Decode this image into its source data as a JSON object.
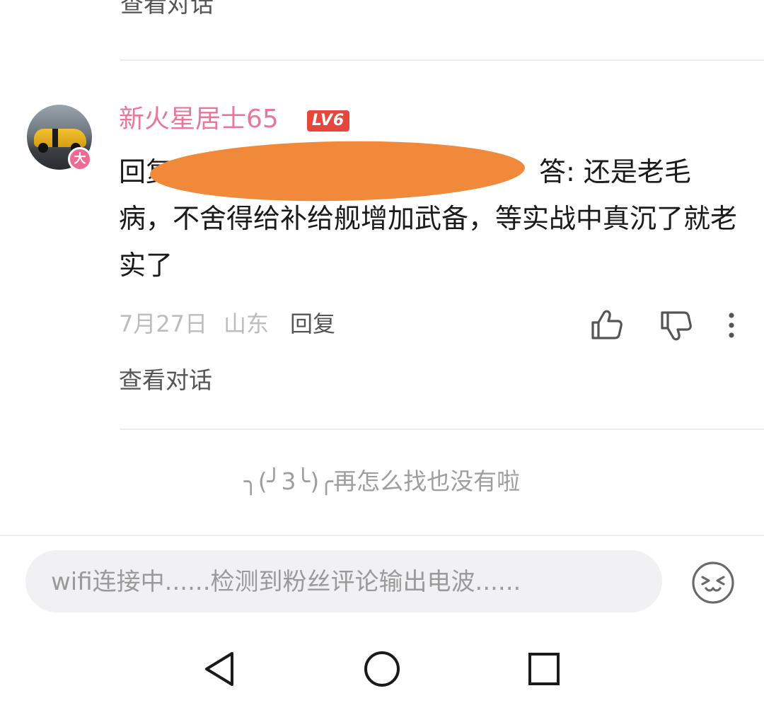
{
  "previous_comment": {
    "view_conversation": "查看对话"
  },
  "comment": {
    "username": "新火星居士65",
    "level_badge": "LV6",
    "avatar_badge": "大",
    "reply_prefix": "回复",
    "reply_target_tail": "答",
    "text": ": 还是老毛病，不舍得给补给舰增加武备，等实战中真沉了就老实了",
    "date": "7月27日",
    "location": "山东",
    "reply_label": "回复",
    "view_conversation": "查看对话"
  },
  "end_of_list": "╮(╯3╰)╭再怎么找也没有啦",
  "comment_input": {
    "placeholder": "wifi连接中......检测到粉丝评论输出电波......"
  },
  "icons": {
    "like": "thumbs-up-icon",
    "dislike": "thumbs-down-icon",
    "more": "more-vertical-icon",
    "emoji": "emoji-icon",
    "nav_back": "triangle-back-icon",
    "nav_home": "circle-home-icon",
    "nav_recent": "square-recent-icon"
  },
  "colors": {
    "username": "#e8779a",
    "level_badge": "#e5473c",
    "avatar_badge": "#f06a93",
    "redaction": "#f08a3a"
  }
}
